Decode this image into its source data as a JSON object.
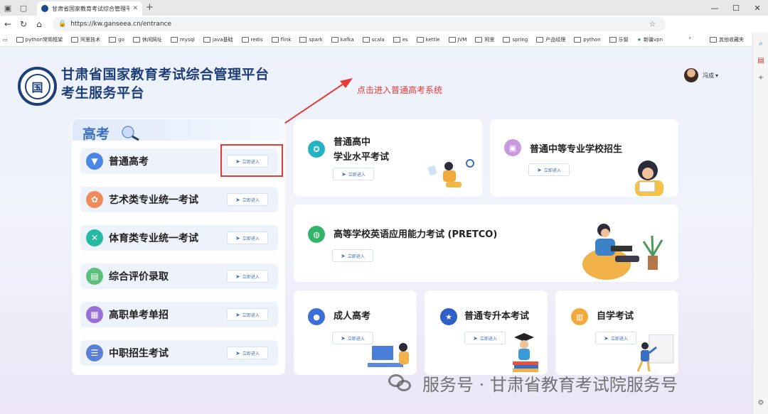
{
  "browser": {
    "tab_title": "甘肃省国家教育考试综合管理平台",
    "url": "https://kw.ganseea.cn/entrance",
    "bookmarks": [
      "python常用框架",
      "阿里技术",
      "go",
      "休闲网址",
      "mysql",
      "java基础",
      "redis",
      "flink",
      "spark",
      "kafka",
      "scala",
      "es",
      "kettle",
      "JVM",
      "阿里",
      "spring",
      "产品经理",
      "python",
      "乐智",
      "新疆vpn"
    ],
    "other_bookmarks": "其他收藏夹"
  },
  "header": {
    "title_line1": "甘肃省国家教育考试综合管理平台",
    "title_line2": "考生服务平台",
    "logo_char": "国",
    "username": "冯成",
    "user_caret": "▾"
  },
  "annotation": "点击进入普通高考系统",
  "enter_label": "立即进入",
  "gaokao": {
    "title": "高考",
    "items": [
      {
        "label": "普通高考",
        "icon": "graduation-cap-icon",
        "color": "#4a86e8"
      },
      {
        "label": "艺术类专业统一考试",
        "icon": "art-flower-icon",
        "color": "#f08a5a"
      },
      {
        "label": "体育类专业统一考试",
        "icon": "sports-tools-icon",
        "color": "#26b9a4"
      },
      {
        "label": "综合评价录取",
        "icon": "evaluation-doc-icon",
        "color": "#5cc07a"
      },
      {
        "label": "高职单考单招",
        "icon": "exam-paper-icon",
        "color": "#9a6fd6"
      },
      {
        "label": "中职招生考试",
        "icon": "list-icon",
        "color": "#5b7ed6"
      }
    ]
  },
  "cards": {
    "xueye": {
      "line1": "普通高中",
      "line2": "学业水平考试",
      "icon": "award-badge-icon",
      "color": "#24b3c4"
    },
    "zhongzhuan": {
      "label": "普通中等专业学校招生",
      "icon": "student-card-icon",
      "color": "#c79ae0"
    },
    "pretco": {
      "label": "高等学校英语应用能力考试 (PRETCO)",
      "icon": "chat-bubble-icon",
      "color": "#34b36b"
    },
    "chengren": {
      "label": "成人高考",
      "icon": "person-icon",
      "color": "#3d6ed8"
    },
    "zhuanshengben": {
      "label": "普通专升本考试",
      "icon": "star-badge-icon",
      "color": "#2f5fc8"
    },
    "zixue": {
      "label": "自学考试",
      "icon": "books-icon",
      "color": "#f2a93b"
    }
  },
  "watermark": "服务号 · 甘肃省教育考试院服务号"
}
